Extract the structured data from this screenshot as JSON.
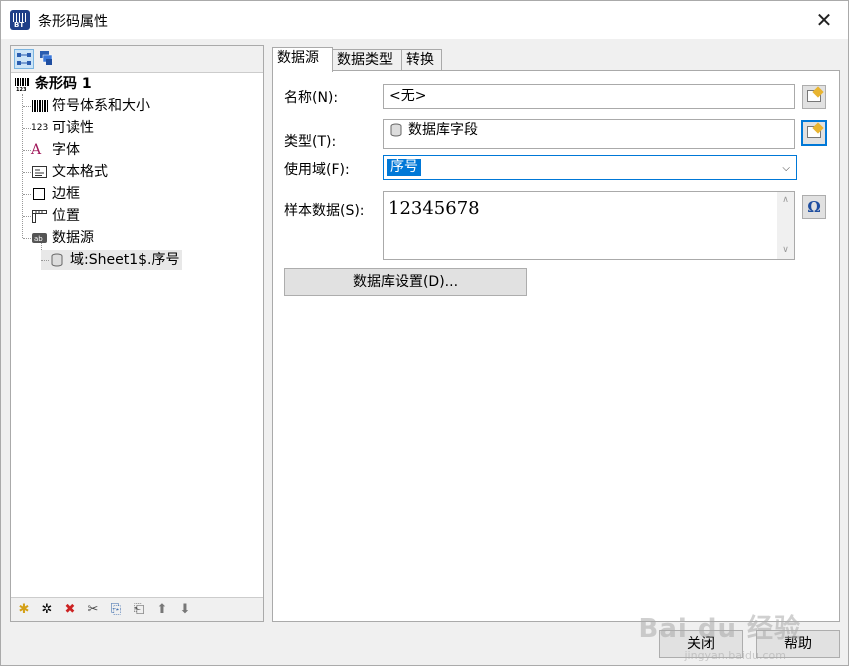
{
  "window": {
    "title": "条形码属性",
    "close_glyph": "✕"
  },
  "left": {
    "tree": {
      "root": "条形码 1",
      "items": [
        {
          "label": "符号体系和大小",
          "icon": "barcode-bars-icon"
        },
        {
          "label": "可读性",
          "icon": "readability-123-icon",
          "icon_text": "123"
        },
        {
          "label": "字体",
          "icon": "font-icon",
          "icon_text": "A"
        },
        {
          "label": "文本格式",
          "icon": "text-format-icon"
        },
        {
          "label": "边框",
          "icon": "border-icon"
        },
        {
          "label": "位置",
          "icon": "position-ruler-icon"
        },
        {
          "label": "数据源",
          "icon": "datasource-icon",
          "icon_text": "ab"
        }
      ],
      "child": "域:Sheet1$.序号"
    },
    "bottom_icons": [
      "new-icon",
      "wand-icon",
      "delete-icon",
      "cut-icon",
      "copy-icon",
      "paste-icon",
      "move-up-icon",
      "move-down-icon"
    ],
    "bottom_glyphs": [
      "✱",
      "✲",
      "✖",
      "✂",
      "⎘",
      "⎗",
      "⬆",
      "⬇"
    ]
  },
  "tabs": [
    "数据源",
    "数据类型",
    "转换"
  ],
  "form": {
    "name_label": "名称(N):",
    "name_value": "<无>",
    "type_label": "类型(T):",
    "type_value": "数据库字段",
    "use_field_label": "使用域(F):",
    "use_field_value": "序号",
    "sample_label": "样本数据(S):",
    "sample_value": "12345678",
    "omega_glyph": "Ω",
    "db_settings_button": "数据库设置(D)..."
  },
  "footer": {
    "close_button": "关闭",
    "help_button": "帮助"
  },
  "watermark": {
    "main": "Bai du 经验",
    "sub": "jingyan.baidu.com"
  }
}
